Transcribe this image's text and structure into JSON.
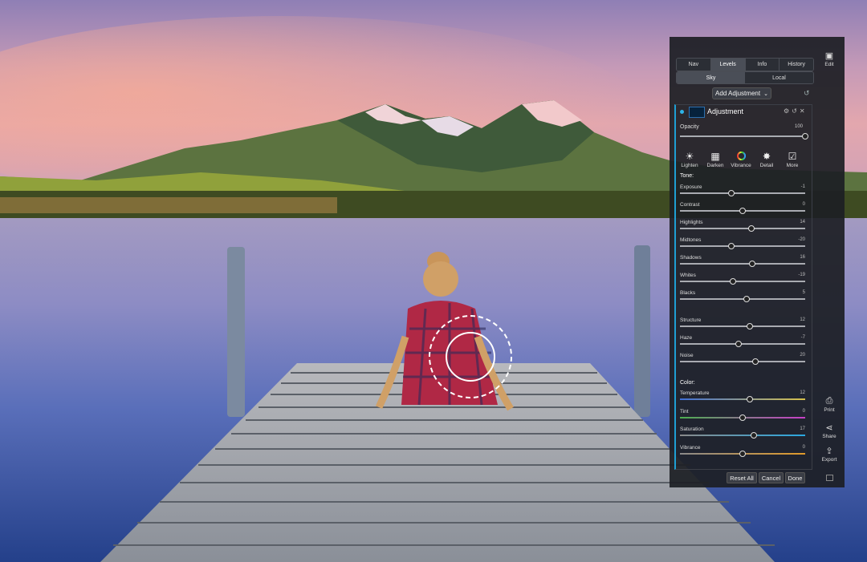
{
  "tabs": [
    "Nav",
    "Levels",
    "Info",
    "History"
  ],
  "active_tab": "Levels",
  "subtabs": [
    "Sky",
    "Local"
  ],
  "active_subtab": "Sky",
  "add_adjustment": "Add Adjustment",
  "adjustment": {
    "title": "Adjustment",
    "swatch_color": "#06223c",
    "opacity": {
      "label": "Opacity",
      "value": "100",
      "level": 1.0
    }
  },
  "tools": [
    {
      "label": "Lighten",
      "icon": "sun-icon"
    },
    {
      "label": "Darken",
      "icon": "darken-icon"
    },
    {
      "label": "Vibrance",
      "icon": "color-wheel-icon"
    },
    {
      "label": "Detail",
      "icon": "detail-icon"
    },
    {
      "label": "More",
      "icon": "more-checkbox-icon"
    }
  ],
  "tone": {
    "heading": "Tone:",
    "sliders": [
      {
        "label": "Exposure",
        "value": "-1",
        "level": 0.41
      },
      {
        "label": "Contrast",
        "value": "0",
        "level": 0.5
      },
      {
        "label": "Highlights",
        "value": "14",
        "level": 0.57
      },
      {
        "label": "Midtones",
        "value": "-20",
        "level": 0.41
      },
      {
        "label": "Shadows",
        "value": "16",
        "level": 0.58
      },
      {
        "label": "Whites",
        "value": "-19",
        "level": 0.42
      },
      {
        "label": "Blacks",
        "value": "5",
        "level": 0.53
      }
    ]
  },
  "detail_sliders": [
    {
      "label": "Structure",
      "value": "12",
      "level": 0.56
    },
    {
      "label": "Haze",
      "value": "-7",
      "level": 0.47
    },
    {
      "label": "Noise",
      "value": "20",
      "level": 0.6
    }
  ],
  "color": {
    "heading": "Color:",
    "sliders": [
      {
        "label": "Temperature",
        "value": "12",
        "level": 0.56,
        "gradient": [
          "#3f6fd6",
          "#d7c14a"
        ]
      },
      {
        "label": "Tint",
        "value": "0",
        "level": 0.5,
        "gradient": [
          "#4caf50",
          "#c83fc8"
        ]
      },
      {
        "label": "Saturation",
        "value": "17",
        "level": 0.59,
        "gradient": [
          "#8a8a8a",
          "#2aa8e0"
        ]
      },
      {
        "label": "Vibrance",
        "value": "0",
        "level": 0.5,
        "gradient": [
          "#8a8a8a",
          "#e09a2a"
        ]
      }
    ]
  },
  "buttons": {
    "reset": "Reset All",
    "cancel": "Cancel",
    "done": "Done"
  },
  "sidebar": [
    {
      "label": "Edit",
      "icon": "image-icon"
    },
    {
      "label": "Print",
      "icon": "printer-icon"
    },
    {
      "label": "Share",
      "icon": "share-icon"
    },
    {
      "label": "Export",
      "icon": "export-icon"
    }
  ]
}
